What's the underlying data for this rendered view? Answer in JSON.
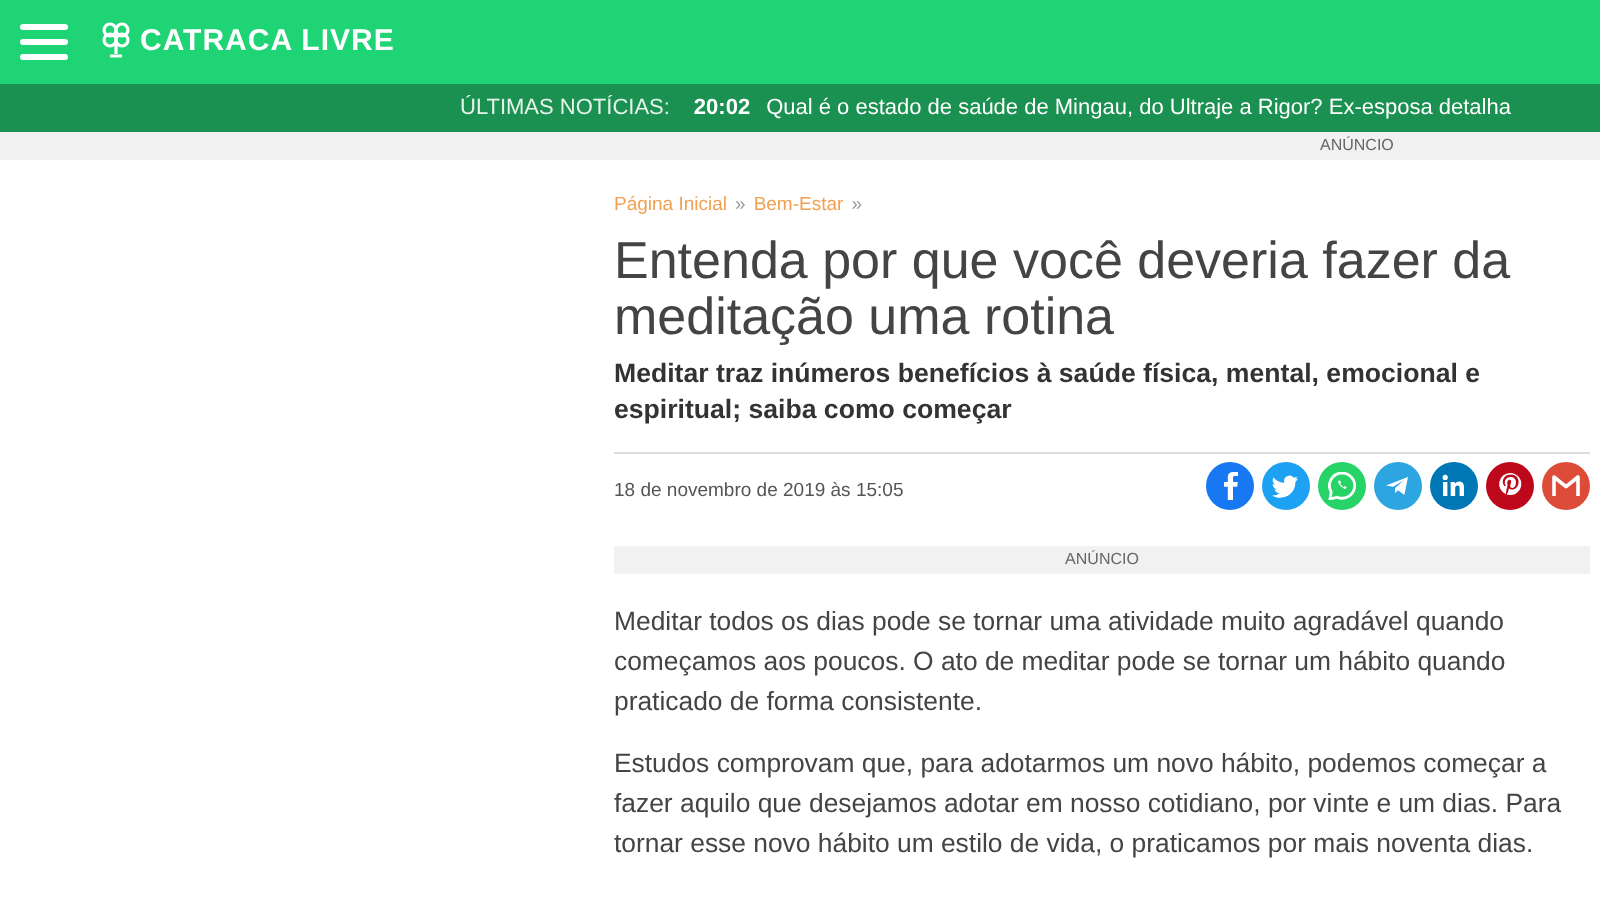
{
  "header": {
    "logo": "CATRACA LIVRE"
  },
  "ticker": {
    "label": "ÚLTIMAS NOTÍCIAS:",
    "time": "20:02",
    "headline": "Qual é o estado de saúde de Mingau, do Ultraje a Rigor? Ex-esposa detalha"
  },
  "top_ad": {
    "label": "ANÚNCIO"
  },
  "breadcrumb": [
    {
      "kind": "link",
      "text": "Página Inicial"
    },
    {
      "kind": "separator",
      "text": "»"
    },
    {
      "kind": "link",
      "text": "Bem-Estar"
    },
    {
      "kind": "separator",
      "text": "»"
    }
  ],
  "article": {
    "title": "Entenda por que você deveria fazer da meditação uma rotina",
    "subtitle": "Meditar traz inúmeros benefícios à saúde física, mental, emocional e espiritual; saiba como começar",
    "date": "18 de novembro de 2019 às 15:05",
    "ad_label": "ANÚNCIO",
    "paragraphs": [
      "Meditar todos os dias pode se tornar uma atividade muito agradável quando começamos aos poucos. O ato de meditar pode se tornar um hábito quando praticado de forma consistente.",
      "Estudos comprovam que, para adotarmos um novo hábito, podemos começar a fazer aquilo que desejamos adotar em nosso cotidiano, por vinte e um dias. Para tornar esse novo hábito um estilo de vida, o praticamos por mais noventa dias."
    ]
  }
}
